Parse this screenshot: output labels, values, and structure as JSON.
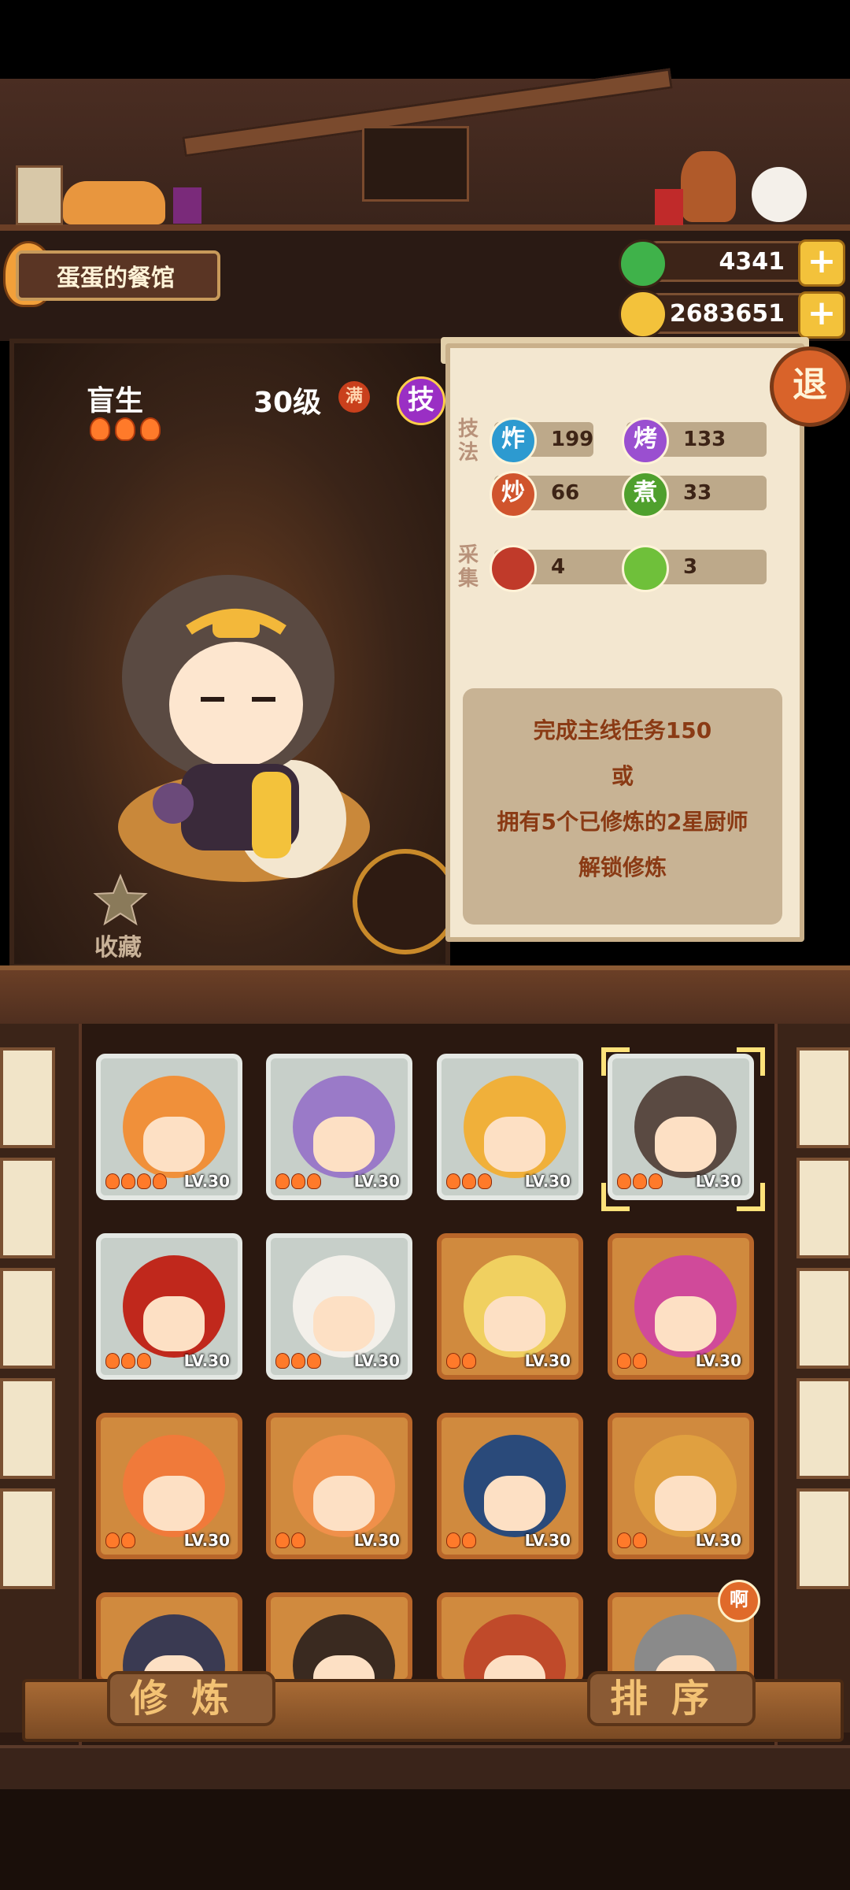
{
  "restaurant": {
    "name": "蛋蛋的餐馆"
  },
  "currencies": {
    "jade": {
      "value": "4341",
      "color": "#3fb24a"
    },
    "coins": {
      "value": "2683651",
      "color": "#f3c23b"
    }
  },
  "exit_label": "退",
  "chef": {
    "name": "盲生",
    "stars": 3,
    "level": "30级",
    "max_badge": "满",
    "skill_badge": "技",
    "favorite_label": "收藏"
  },
  "skills": {
    "section_label": "技法",
    "items": [
      {
        "icon_text": "炸",
        "value": "199",
        "color": "#2d9ad0"
      },
      {
        "icon_text": "烤",
        "value": "133",
        "color": "#9a4fd0"
      },
      {
        "icon_text": "炒",
        "value": "66",
        "color": "#d0542d"
      },
      {
        "icon_text": "煮",
        "value": "33",
        "color": "#4fa02d"
      }
    ]
  },
  "gather": {
    "section_label": "采集",
    "items": [
      {
        "icon_name": "meat-icon",
        "value": "4",
        "color": "#c03a2a"
      },
      {
        "icon_name": "vegetable-icon",
        "value": "3",
        "color": "#6fc03a"
      }
    ]
  },
  "unlock": {
    "line1": "完成主线任务150",
    "line2": "或",
    "line3": "拥有5个已修炼的2星厨师",
    "line4": "解锁修炼"
  },
  "roster": [
    {
      "lv": "LV.30",
      "stars": 4,
      "frame": "gray",
      "hair": "#f0903a"
    },
    {
      "lv": "LV.30",
      "stars": 3,
      "frame": "gray",
      "hair": "#9a7ac8"
    },
    {
      "lv": "LV.30",
      "stars": 3,
      "frame": "gray",
      "hair": "#f0b03a"
    },
    {
      "lv": "LV.30",
      "stars": 3,
      "frame": "gray",
      "hair": "#5a4a42",
      "selected": true
    },
    {
      "lv": "LV.30",
      "stars": 3,
      "frame": "gray",
      "hair": "#c0281c"
    },
    {
      "lv": "LV.30",
      "stars": 3,
      "frame": "gray",
      "hair": "#f3f0ea"
    },
    {
      "lv": "LV.30",
      "stars": 2,
      "frame": "gold",
      "hair": "#f0d060"
    },
    {
      "lv": "LV.30",
      "stars": 2,
      "frame": "gold",
      "hair": "#d04a9a"
    },
    {
      "lv": "LV.30",
      "stars": 2,
      "frame": "gold",
      "hair": "#f07a3a"
    },
    {
      "lv": "LV.30",
      "stars": 2,
      "frame": "gold",
      "hair": "#f0904a"
    },
    {
      "lv": "LV.30",
      "stars": 2,
      "frame": "gold",
      "hair": "#2a4a7a"
    },
    {
      "lv": "LV.30",
      "stars": 2,
      "frame": "gold",
      "hair": "#e0a040"
    },
    {
      "lv": "",
      "stars": 0,
      "frame": "gold",
      "hair": "#3a3a52"
    },
    {
      "lv": "",
      "stars": 0,
      "frame": "gold",
      "hair": "#3a2a20"
    },
    {
      "lv": "",
      "stars": 0,
      "frame": "gold",
      "hair": "#c04a2a"
    },
    {
      "lv": "",
      "stars": 0,
      "frame": "gold",
      "hair": "#8a8a8a"
    }
  ],
  "new_badge": "啊",
  "buttons": {
    "cultivate": "修炼",
    "sort": "排序"
  }
}
